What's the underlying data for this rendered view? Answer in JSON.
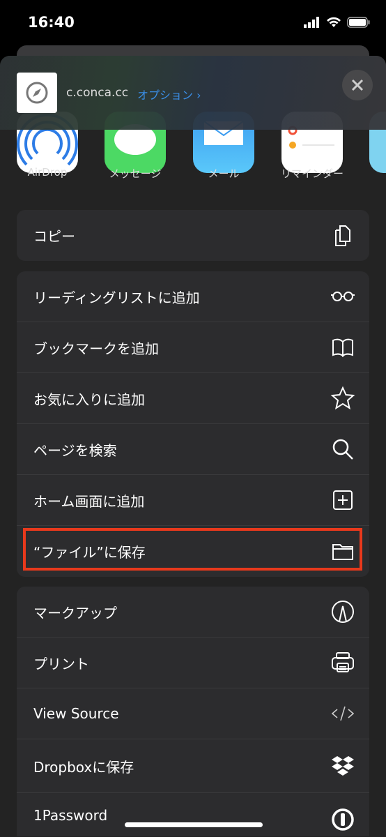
{
  "status_bar": {
    "time": "16:40"
  },
  "header": {
    "site": "c.conca.cc",
    "options_label": "オプション ›",
    "favicon": "safari-compass-icon",
    "close_icon": "close-icon"
  },
  "apps": [
    {
      "label": "AirDrop",
      "color": "#2d7ce6"
    },
    {
      "label": "メッセージ",
      "color": "#4cd964"
    },
    {
      "label": "メール",
      "color": "#3d9df0"
    },
    {
      "label": "リマインダー",
      "color": "#ffffff"
    },
    {
      "label": "",
      "color": "#7fd3f0"
    }
  ],
  "groups": [
    [
      {
        "label": "コピー",
        "icon": "copy-icon"
      }
    ],
    [
      {
        "label": "リーディングリストに追加",
        "icon": "glasses-icon"
      },
      {
        "label": "ブックマークを追加",
        "icon": "book-icon"
      },
      {
        "label": "お気に入りに追加",
        "icon": "star-icon"
      },
      {
        "label": "ページを検索",
        "icon": "search-icon"
      },
      {
        "label": "ホーム画面に追加",
        "icon": "plus-square-icon"
      },
      {
        "label": "“ファイル”に保存",
        "icon": "folder-icon",
        "highlighted": true
      }
    ],
    [
      {
        "label": "マークアップ",
        "icon": "markup-icon"
      },
      {
        "label": "プリント",
        "icon": "printer-icon"
      },
      {
        "label": "View Source",
        "icon": "code-icon"
      },
      {
        "label": "Dropboxに保存",
        "icon": "dropbox-icon"
      },
      {
        "label": "1Password",
        "icon": "1password-icon"
      }
    ]
  ],
  "colors": {
    "highlight": "#e8391c",
    "link": "#3a8ee6"
  }
}
